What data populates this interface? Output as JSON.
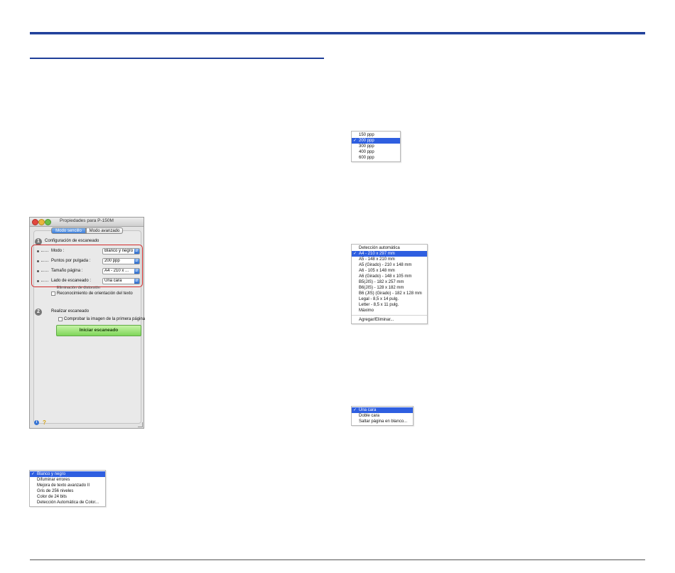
{
  "dialog": {
    "title": "Propiedades para P-150M",
    "tabs": [
      "Modo sencillo",
      "Modo avanzado"
    ],
    "section1": "Configuración de escaneado",
    "fields": [
      {
        "label": "Modo :",
        "value": "Blanco y negro"
      },
      {
        "label": "Puntos por pulgada :",
        "value": "200 ppp"
      },
      {
        "label": "Tamaño página :",
        "value": "A4 - 210 x ..."
      },
      {
        "label": "Lado de escaneado :",
        "value": "Una cara"
      }
    ],
    "partial_checkbox": "Eliminación de distorsión",
    "checkbox_orientation": "Reconocimiento de orientación del texto",
    "section2": "Realizar escaneado",
    "checkbox_first_page": "Comprobar la imagen de la primera página",
    "start_button": "Iniciar escaneado",
    "step1": "1",
    "step2": "2"
  },
  "menu_mode": {
    "selected": "Blanco y negro",
    "items": [
      "Blanco y negro",
      "Difuminar errores",
      "Mejora de texto avanzado II",
      "Gris de 256 niveles",
      "Color de 24 bits",
      "Detección Automática de Color..."
    ]
  },
  "menu_dpi": {
    "selected": "200 ppp",
    "items": [
      "150 ppp",
      "200 ppp",
      "300 ppp",
      "400 ppp",
      "600 ppp"
    ]
  },
  "menu_size": {
    "selected": "A4 - 210 x 297 mm",
    "items": [
      "Detección automática",
      "A4 - 210 x 297 mm",
      "A5 - 148 x 210 mm",
      "A5 (Girado) - 210 x 148 mm",
      "A6 - 105 x 148 mm",
      "A6 (Girado) - 148 x 105 mm",
      "B5(JIS) - 182 x 257 mm",
      "B6(JIS) - 128 x 182 mm",
      "B6 (JIS) (Girado) - 182 x 128 mm",
      "Legal - 8,5 x 14 pulg.",
      "Letter - 8,5 x 11 pulg.",
      "Máximo"
    ],
    "footer": "Agregar/Eliminar..."
  },
  "menu_side": {
    "selected": "Una cara",
    "items": [
      "Una cara",
      "Doble cara",
      "Saltar página en blanco..."
    ]
  },
  "colors": {
    "rule": "#1f3f99",
    "highlight": "#d22b2b",
    "menu_selection": "#2f5fe0",
    "start_button": "#7fd65a"
  }
}
